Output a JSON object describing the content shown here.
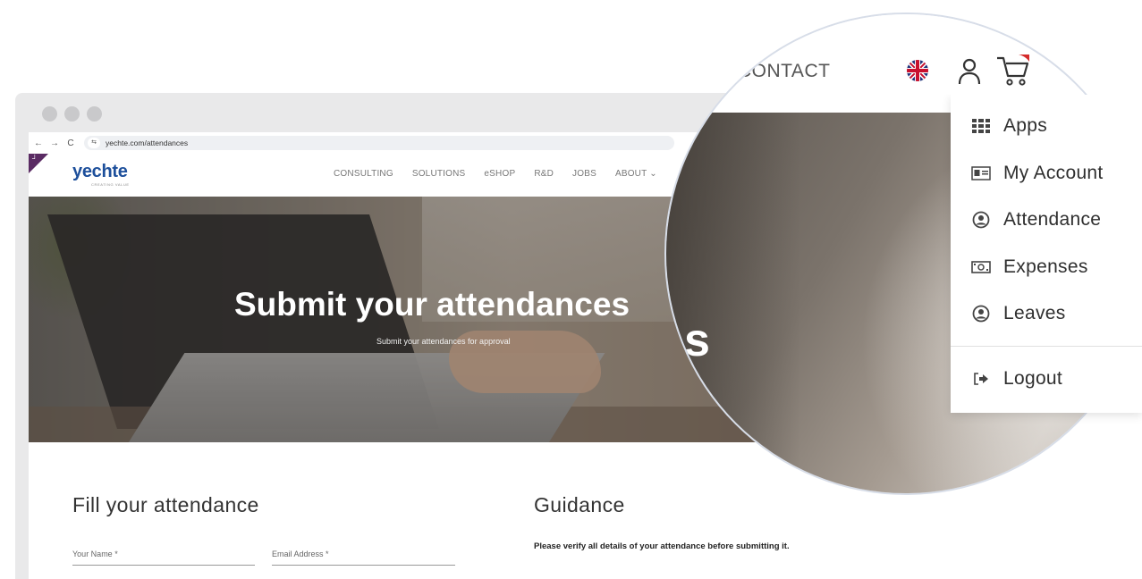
{
  "browser": {
    "url": "yechte.com/attendances",
    "back_icon": "←",
    "forward_icon": "→",
    "reload_icon": "C",
    "site_settings_icon": "⇆"
  },
  "site": {
    "brand": "yechte",
    "brand_tagline": "CREATING VALUE",
    "corner_mark": "┘",
    "nav": [
      "CONSULTING",
      "SOLUTIONS",
      "eSHOP",
      "R&D",
      "JOBS",
      "ABOUT ⌄"
    ],
    "hero": {
      "title": "Submit your attendances",
      "subtitle": "Submit your attendances for approval"
    },
    "form": {
      "title": "Fill your attendance",
      "name_label": "Your Name *",
      "email_label": "Email Address *"
    },
    "guidance": {
      "title": "Guidance",
      "text": "Please verify all details of your attendance before submitting it."
    }
  },
  "zoom": {
    "contact_label": "CONTACT",
    "hero_fragment": "s",
    "menu": [
      {
        "label": "Apps",
        "icon": "grid-icon"
      },
      {
        "label": "My Account",
        "icon": "id-card-icon"
      },
      {
        "label": "Attendance",
        "icon": "user-circle-icon"
      },
      {
        "label": "Expenses",
        "icon": "money-icon"
      },
      {
        "label": "Leaves",
        "icon": "user-circle-icon"
      },
      {
        "label": "Logout",
        "icon": "logout-icon"
      }
    ]
  },
  "colors": {
    "brand_blue": "#1d4f9b",
    "corner_purple": "#5a2b63",
    "cart_badge_red": "#d42b2b"
  }
}
